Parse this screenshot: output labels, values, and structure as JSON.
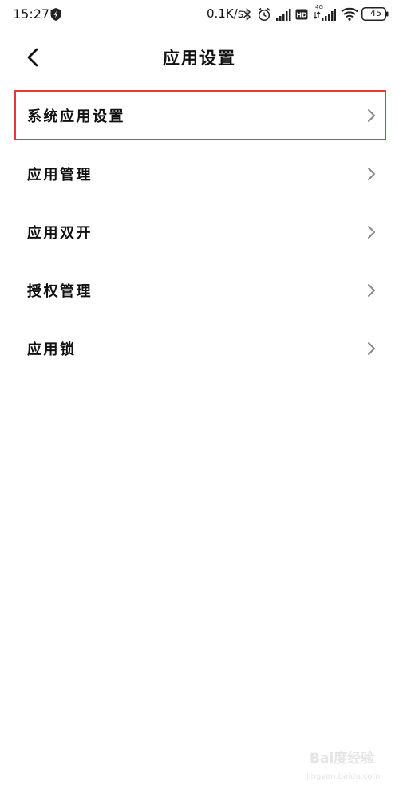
{
  "status_bar": {
    "time": "15:27",
    "net_speed": "0.1K/s",
    "network_label": "4G",
    "battery": "45"
  },
  "header": {
    "title": "应用设置"
  },
  "menu": {
    "items": [
      {
        "label": "系统应用设置",
        "highlighted": true
      },
      {
        "label": "应用管理"
      },
      {
        "label": "应用双开"
      },
      {
        "label": "授权管理"
      },
      {
        "label": "应用锁"
      }
    ]
  },
  "watermark": {
    "main": "Bai度经验",
    "sub": "jingyan.baidu.com"
  },
  "colors": {
    "highlight_border": "#e53935",
    "chevron": "#888888",
    "text": "#111111"
  }
}
